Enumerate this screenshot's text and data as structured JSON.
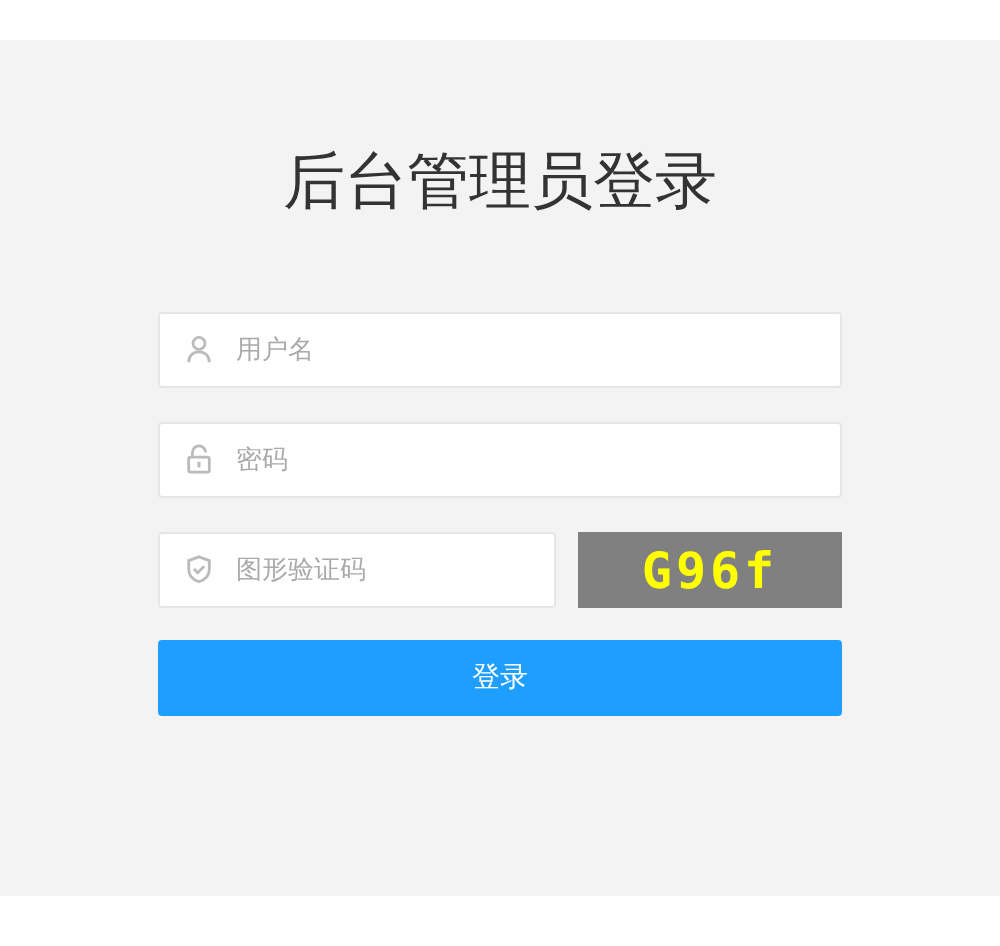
{
  "title": "后台管理员登录",
  "fields": [
    {
      "kind": "user",
      "placeholder": "用户名"
    },
    {
      "kind": "lock",
      "placeholder": "密码"
    }
  ],
  "captcha": {
    "placeholder": "图形验证码",
    "code": "G96f"
  },
  "submit": "登录"
}
